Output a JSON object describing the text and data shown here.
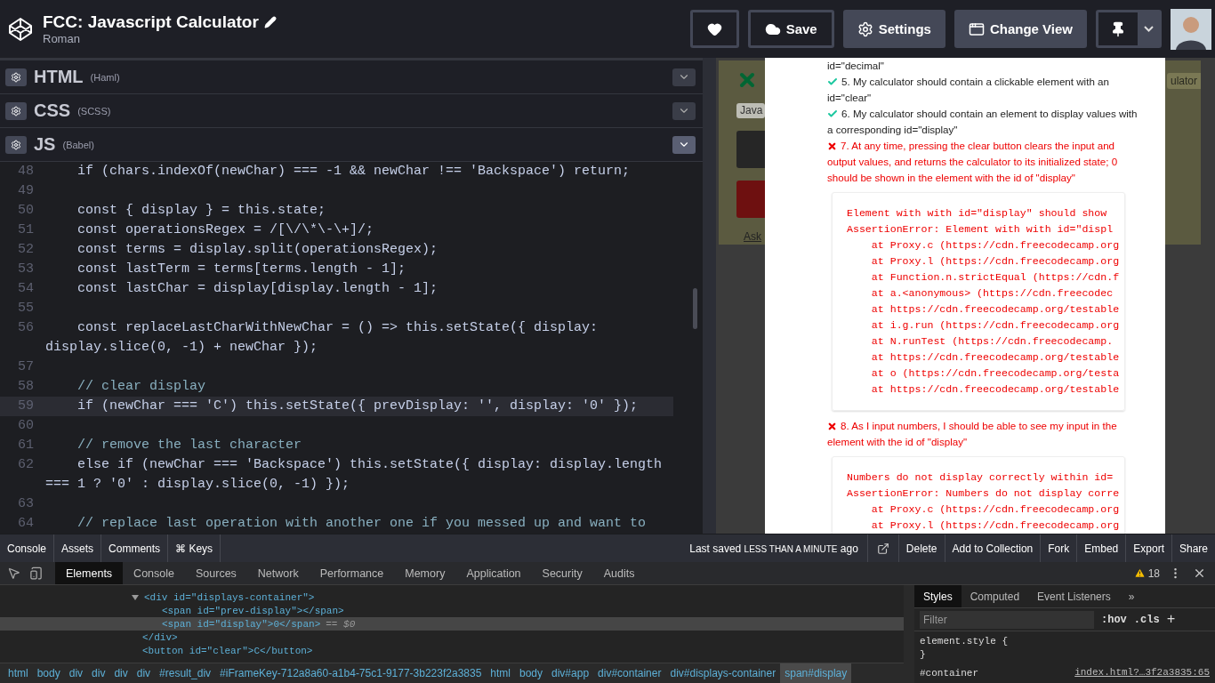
{
  "header": {
    "title": "FCC: Javascript Calculator",
    "author": "Roman",
    "buttons": [
      {
        "kind": "heart"
      },
      {
        "kind": "save",
        "label": "Save"
      },
      {
        "kind": "settings",
        "label": "Settings"
      },
      {
        "kind": "view",
        "label": "Change View"
      },
      {
        "kind": "pin"
      }
    ]
  },
  "editors": [
    {
      "name": "HTML",
      "preprocessor": "(Haml)",
      "active": false
    },
    {
      "name": "CSS",
      "preprocessor": "(SCSS)",
      "active": false
    },
    {
      "name": "JS",
      "preprocessor": "(Babel)",
      "active": true
    }
  ],
  "code_lines": [
    {
      "number": "48",
      "kind": "code",
      "active": false,
      "text": "    if (chars.indexOf(newChar) === -1 && newChar !== 'Backspace') return;"
    },
    {
      "number": "49",
      "active": false
    },
    {
      "number": "50",
      "kind": "code",
      "active": false,
      "text": "    const { display } = this.state;"
    },
    {
      "number": "51",
      "kind": "code",
      "active": false,
      "text": "    const operationsRegex = /[\\/\\*\\-\\+]/;"
    },
    {
      "number": "52",
      "kind": "code",
      "active": false,
      "text": "    const terms = display.split(operationsRegex);"
    },
    {
      "number": "53",
      "kind": "code",
      "active": false,
      "text": "    const lastTerm = terms[terms.length - 1];"
    },
    {
      "number": "54",
      "kind": "code",
      "active": false,
      "text": "    const lastChar = display[display.length - 1];"
    },
    {
      "number": "55",
      "active": false
    },
    {
      "number": "56",
      "kind": "code",
      "active": false,
      "text": "    const replaceLastCharWithNewChar = () => this.setState({ display:",
      "wrap": "display.slice(0, -1) + newChar });"
    },
    {
      "number": "57",
      "active": false
    },
    {
      "number": "58",
      "kind": "comment",
      "active": false,
      "text": "    // clear display"
    },
    {
      "number": "59",
      "kind": "code",
      "active": true,
      "text": "    if (newChar === 'C') this.setState({ prevDisplay: '', display: '0' });"
    },
    {
      "number": "60",
      "active": false
    },
    {
      "number": "61",
      "kind": "comment",
      "active": false,
      "text": "    // remove the last character"
    },
    {
      "number": "62",
      "kind": "code",
      "active": false,
      "text": "    else if (newChar === 'Backspace') this.setState({ display: display.length",
      "wrap": "=== 1 ? '0' : display.slice(0, -1) });"
    },
    {
      "number": "63",
      "active": false
    },
    {
      "number": "64",
      "kind": "comment",
      "active": false,
      "text": "    // replace last operation with another one if you messed up and want to"
    }
  ],
  "preview": {
    "select": "Java",
    "tag": "ulator",
    "link": "Ask"
  },
  "tests": {
    "lead_text": "id=\"decimal\"",
    "items": [
      {
        "passed": true,
        "text": "5. My calculator should contain a clickable element with an id=\"clear\""
      },
      {
        "passed": true,
        "text": "6. My calculator should contain an element to display values with a corresponding id=\"display\""
      },
      {
        "passed": false,
        "text": "7. At any time, pressing the clear button clears the input and output values, and returns the calculator to its initialized state; 0 should be shown in the element with the id of \"display\"",
        "error": [
          "Element with with id=\"display\" should show",
          "AssertionError: Element with with id=\"displ",
          "    at Proxy.c (https://cdn.freecodecamp.org",
          "    at Proxy.l (https://cdn.freecodecamp.org",
          "    at Function.n.strictEqual (https://cdn.f",
          "    at a.<anonymous> (https://cdn.freecodec",
          "    at https://cdn.freecodecamp.org/testable",
          "    at i.g.run (https://cdn.freecodecamp.org",
          "    at N.runTest (https://cdn.freecodecamp.",
          "    at https://cdn.freecodecamp.org/testable",
          "    at o (https://cdn.freecodecamp.org/testa",
          "    at https://cdn.freecodecamp.org/testable"
        ]
      },
      {
        "passed": false,
        "text": "8. As I input numbers, I should be able to see my input in the element with the id of \"display\"",
        "error": [
          "Numbers do not display correctly within id=",
          "AssertionError: Numbers do not display corre",
          "    at Proxy.c (https://cdn.freecodecamp.org",
          "    at Proxy.l (https://cdn.freecodecamp.org"
        ]
      }
    ]
  },
  "footer": {
    "left": [
      "Console",
      "Assets",
      "Comments",
      "⌘ Keys"
    ],
    "last_saved": {
      "prefix": "Last saved",
      "time": "LESS THAN A MINUTE",
      "suffix": "ago"
    },
    "right": [
      "Delete",
      "Add to Collection",
      "Fork",
      "Embed",
      "Export",
      "Share"
    ]
  },
  "devtools": {
    "tabs": [
      {
        "label": "Elements",
        "selected": true
      },
      {
        "label": "Console",
        "selected": false
      },
      {
        "label": "Sources",
        "selected": false
      },
      {
        "label": "Network",
        "selected": false
      },
      {
        "label": "Performance",
        "selected": false
      },
      {
        "label": "Memory",
        "selected": false
      },
      {
        "label": "Application",
        "selected": false
      },
      {
        "label": "Security",
        "selected": false
      },
      {
        "label": "Audits",
        "selected": false
      }
    ],
    "warnings": "18",
    "dom": [
      {
        "text": "<div id=\"displays-container\">",
        "expanded": true,
        "selected": false,
        "close": "</div>",
        "children": [
          {
            "text": "<span id=\"prev-display\"></span>",
            "selected": false
          },
          {
            "text": "<span id=\"display\">0</span>",
            "selected": true,
            "suffix": "== $0"
          }
        ]
      },
      {
        "text": "<button id=\"clear\">C</button>",
        "selected": false
      }
    ],
    "breadcrumbs": [
      {
        "label": "html",
        "selected": false
      },
      {
        "label": "body",
        "selected": false
      },
      {
        "label": "div",
        "selected": false
      },
      {
        "label": "div",
        "selected": false
      },
      {
        "label": "div",
        "selected": false
      },
      {
        "label": "div",
        "selected": false
      },
      {
        "label": "#result_div",
        "selected": false
      },
      {
        "label": "#iFrameKey-712a8a60-a1b4-75c1-9177-3b223f2a3835",
        "selected": false
      },
      {
        "label": "html",
        "selected": false
      },
      {
        "label": "body",
        "selected": false
      },
      {
        "label": "div#app",
        "selected": false
      },
      {
        "label": "div#container",
        "selected": false
      },
      {
        "label": "div#displays-container",
        "selected": false
      },
      {
        "label": "span#display",
        "selected": true
      }
    ],
    "styles": {
      "tabs": [
        {
          "label": "Styles",
          "selected": true
        },
        {
          "label": "Computed",
          "selected": false
        },
        {
          "label": "Event Listeners",
          "selected": false
        }
      ],
      "more": "»",
      "filter_placeholder": "Filter",
      "hov": ":hov",
      "cls": ".cls",
      "add": "+",
      "rule_open": "element.style {",
      "rule_close": "}",
      "selector": "#container",
      "source": "index.html?…3f2a3835:65"
    }
  }
}
